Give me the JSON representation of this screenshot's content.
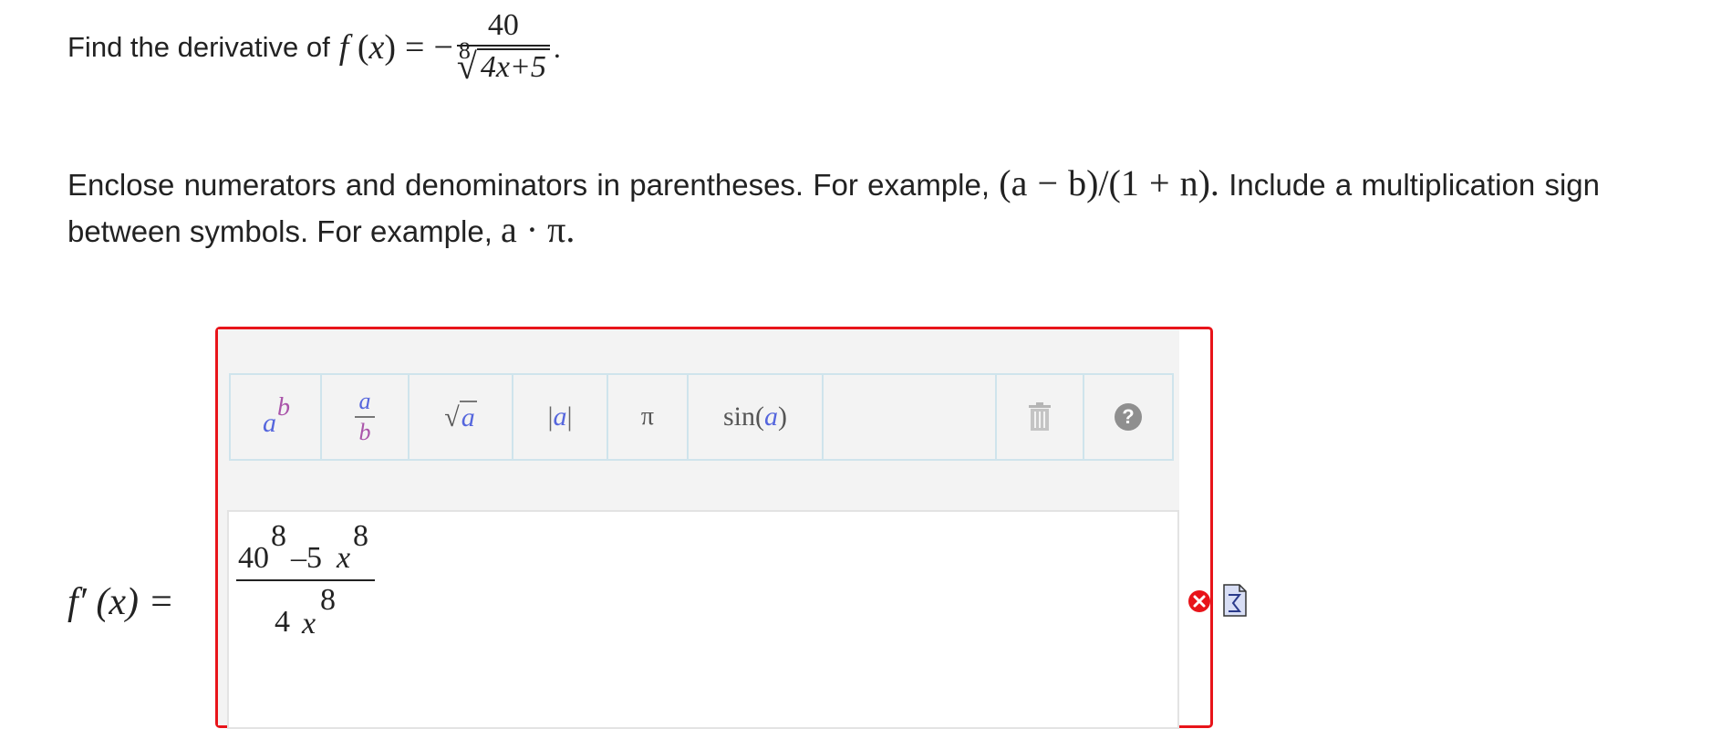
{
  "question": {
    "prefix": "Find the derivative of",
    "function_name": "f",
    "variable": "x",
    "equals": "=",
    "minus": "−",
    "numerator": "40",
    "root_index": "8",
    "radicand": "4x+5",
    "period": "."
  },
  "instructions": {
    "text1": "Enclose numerators and denominators in parentheses. For example,",
    "example1": "(a − b)/(1 + n).",
    "text2": "Include a multiplication sign between symbols. For example,",
    "example2": "a · π."
  },
  "answer": {
    "label": "f′ (x) =",
    "numerator_parts": [
      "40",
      "8",
      "–5",
      "x",
      "8"
    ],
    "denominator_parts": [
      "4",
      "x",
      "8"
    ]
  },
  "toolbar": {
    "power": {
      "base": "a",
      "exp": "b",
      "icon": "power-icon"
    },
    "fraction": {
      "top": "a",
      "bottom": "b",
      "icon": "fraction-icon"
    },
    "sqrt": {
      "sign": "√",
      "arg": "a",
      "icon": "square-root-icon"
    },
    "abs": {
      "left": "|",
      "arg": "a",
      "right": "|",
      "icon": "absolute-value-icon"
    },
    "pi": {
      "symbol": "π",
      "icon": "pi-icon"
    },
    "sin": {
      "fn": "sin",
      "open": "(",
      "arg": "a",
      "close": ")",
      "icon": "sine-icon"
    },
    "trash": {
      "icon": "trash-icon"
    },
    "help": {
      "symbol": "?",
      "icon": "help-icon"
    }
  },
  "status": {
    "error_icon": "error-x-icon",
    "formula_icon": "formula-sigma-icon",
    "error_color": "#e8141a",
    "accent_blue": "#5566dd",
    "accent_purple": "#aa55aa",
    "toolbar_border": "#cfe4ec"
  }
}
